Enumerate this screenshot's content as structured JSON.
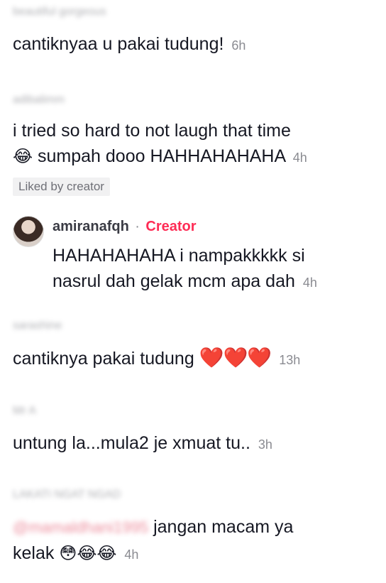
{
  "comments": [
    {
      "username": "beautiful gorgeous",
      "text": "cantiknyaa u pakai tudung!",
      "time": "6h"
    },
    {
      "username": "adibalimm",
      "text_line1": "i tried so hard to not laugh that time",
      "emoji": "😂",
      "text_line2": "sumpah dooo HAHHAHAHAHA",
      "time": "4h",
      "badge": "Liked by creator",
      "reply": {
        "username": "amiranafqh",
        "separator": "·",
        "role": "Creator",
        "text_line1": "HAHAHAHAHA i nampakkkkk si",
        "text_line2": "nasrul dah gelak mcm apa dah",
        "time": "4h"
      }
    },
    {
      "username": "sarashine",
      "text": "cantiknya pakai tudung",
      "hearts": "❤️❤️❤️",
      "time": "13h"
    },
    {
      "username": "Mr A",
      "text": "untung la...mula2 je xmuat tu..",
      "time": "3h"
    },
    {
      "username": "LAKATI NGAT NGAD",
      "mention": "@mamaldhani1995",
      "text_line1": "jangan macam ya",
      "text_line2": "kelak",
      "emojis": "😳😂😂",
      "time": "4h"
    }
  ]
}
